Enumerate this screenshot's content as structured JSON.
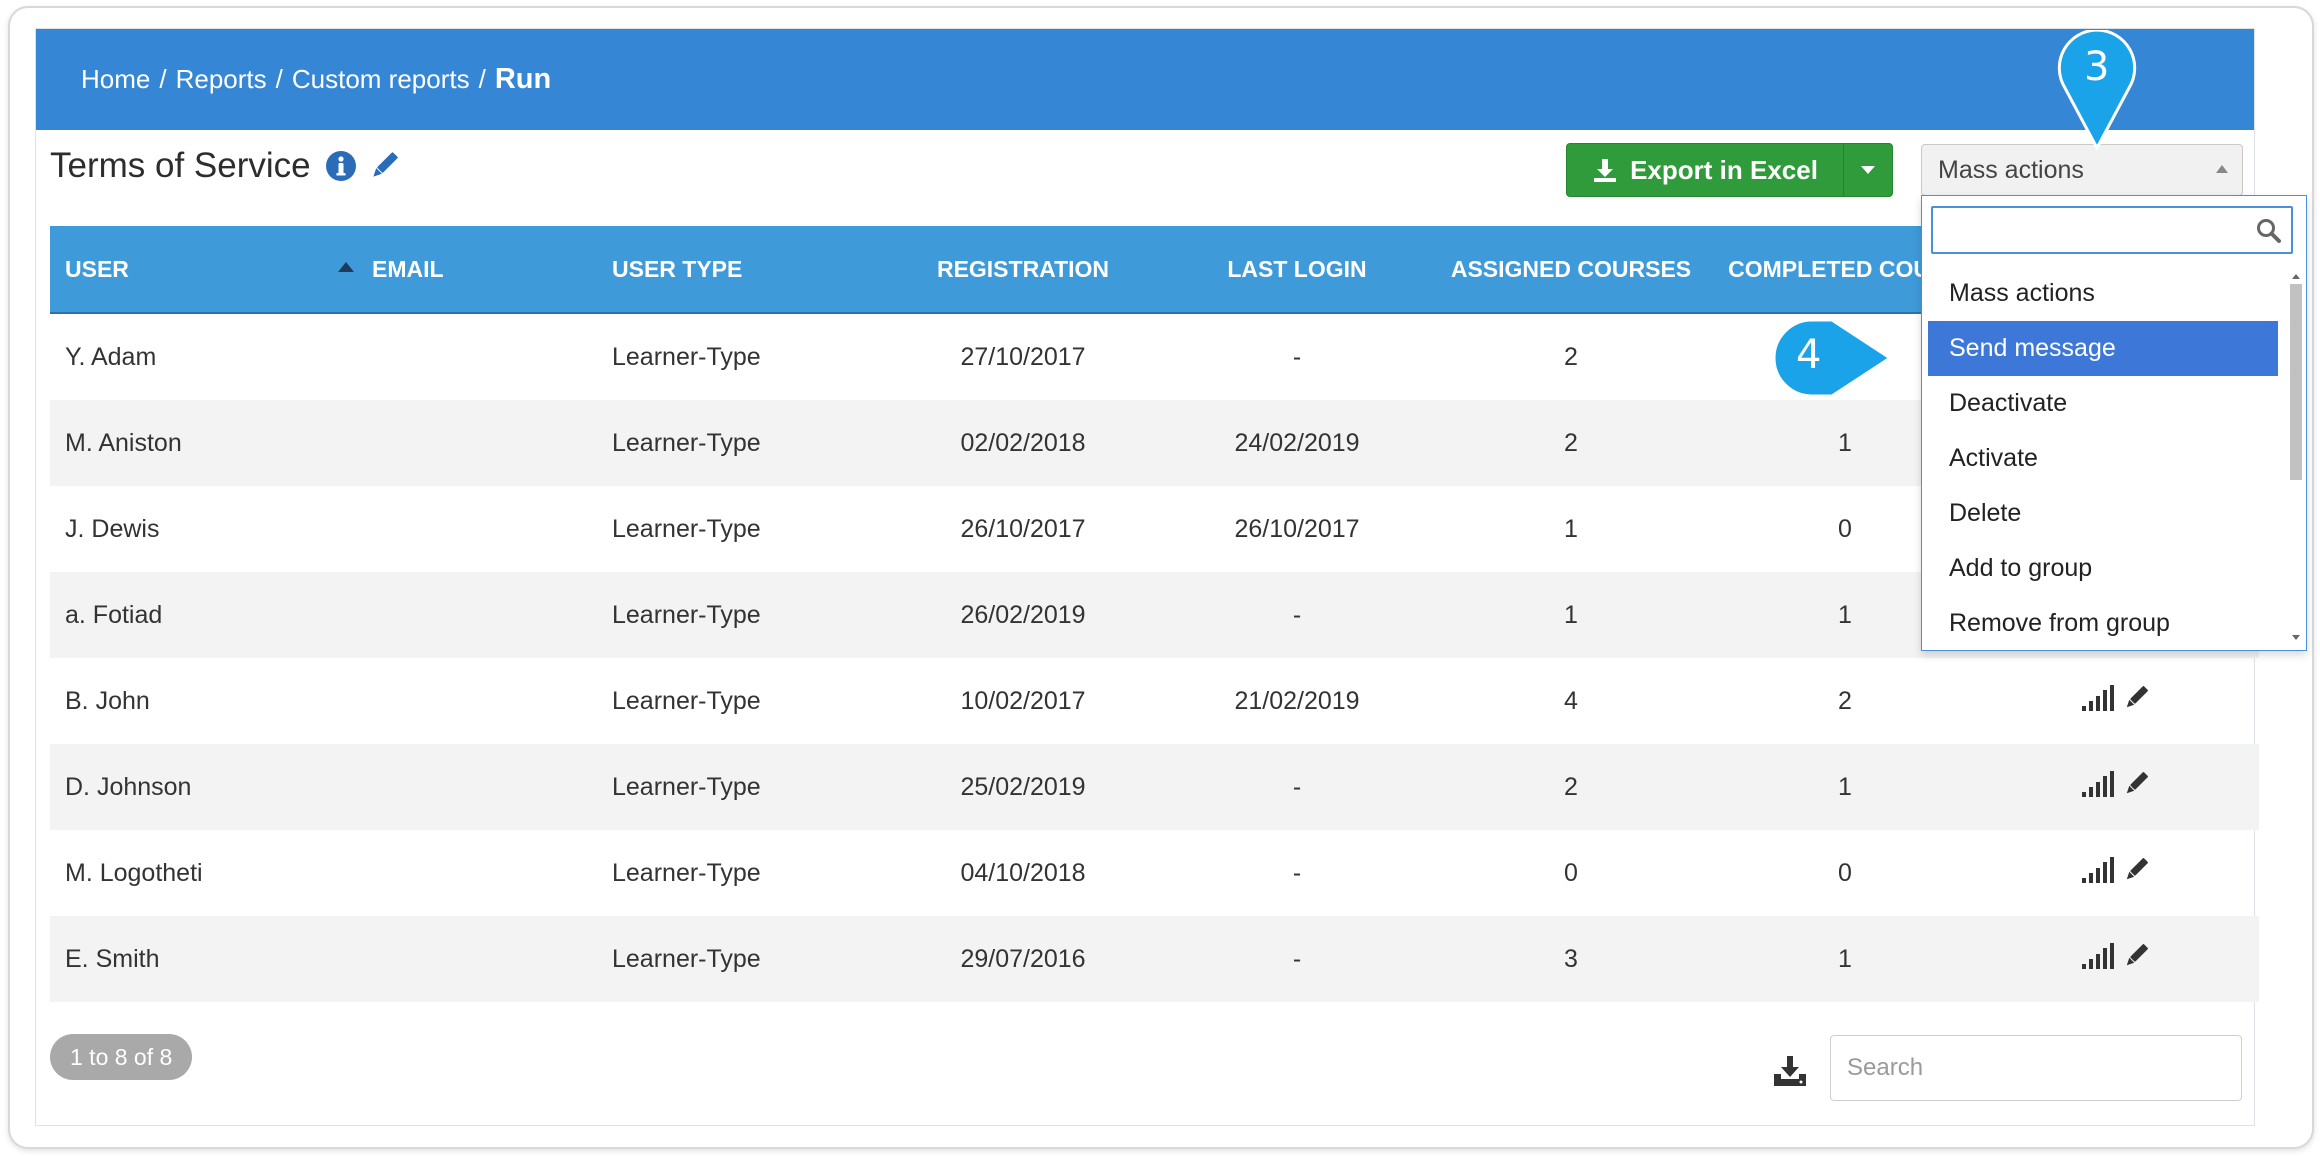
{
  "breadcrumb": {
    "items": [
      "Home",
      "Reports",
      "Custom reports"
    ],
    "separator": "/",
    "current": "Run"
  },
  "page": {
    "title": "Terms of Service"
  },
  "toolbar": {
    "export_label": "Export in Excel",
    "mass_actions_label": "Mass actions"
  },
  "table": {
    "headers": {
      "user": "USER",
      "email": "EMAIL",
      "user_type": "USER TYPE",
      "registration": "REGISTRATION",
      "last_login": "LAST LOGIN",
      "assigned": "ASSIGNED COURSES",
      "completed": "COMPLETED COURS"
    },
    "rows": [
      {
        "user": "Y. Adam",
        "email": "",
        "type": "Learner-Type",
        "registration": "27/10/2017",
        "last_login": "-",
        "assigned": "2",
        "completed": ""
      },
      {
        "user": "M. Aniston",
        "email": "",
        "type": "Learner-Type",
        "registration": "02/02/2018",
        "last_login": "24/02/2019",
        "assigned": "2",
        "completed": "1"
      },
      {
        "user": "J. Dewis",
        "email": "",
        "type": "Learner-Type",
        "registration": "26/10/2017",
        "last_login": "26/10/2017",
        "assigned": "1",
        "completed": "0"
      },
      {
        "user": "a. Fotiad",
        "email": "",
        "type": "Learner-Type",
        "registration": "26/02/2019",
        "last_login": "-",
        "assigned": "1",
        "completed": "1"
      },
      {
        "user": "B. John",
        "email": "",
        "type": "Learner-Type",
        "registration": "10/02/2017",
        "last_login": "21/02/2019",
        "assigned": "4",
        "completed": "2"
      },
      {
        "user": "D. Johnson",
        "email": "",
        "type": "Learner-Type",
        "registration": "25/02/2019",
        "last_login": "-",
        "assigned": "2",
        "completed": "1"
      },
      {
        "user": "M. Logotheti",
        "email": "",
        "type": "Learner-Type",
        "registration": "04/10/2018",
        "last_login": "-",
        "assigned": "0",
        "completed": "0"
      },
      {
        "user": "E. Smith",
        "email": "",
        "type": "Learner-Type",
        "registration": "29/07/2016",
        "last_login": "-",
        "assigned": "3",
        "completed": "1"
      }
    ]
  },
  "pagination": {
    "text": "1 to 8 of 8"
  },
  "footer": {
    "search_placeholder": "Search"
  },
  "dropdown": {
    "search_value": "",
    "options": [
      "Mass actions",
      "Send message",
      "Deactivate",
      "Activate",
      "Delete",
      "Add to group",
      "Remove from group"
    ],
    "highlighted": "Send message"
  },
  "callouts": {
    "step3": "3",
    "step4": "4"
  },
  "colors": {
    "header_blue": "#3586d4",
    "table_header": "#3f9ad9",
    "export_green": "#2f9b3a",
    "highlight": "#3d78d8",
    "callout": "#1aa3e8"
  },
  "icons": {
    "info": "info-icon",
    "edit": "pencil-icon",
    "download": "download-icon",
    "stats": "signal-bars-icon",
    "search": "search-icon"
  }
}
